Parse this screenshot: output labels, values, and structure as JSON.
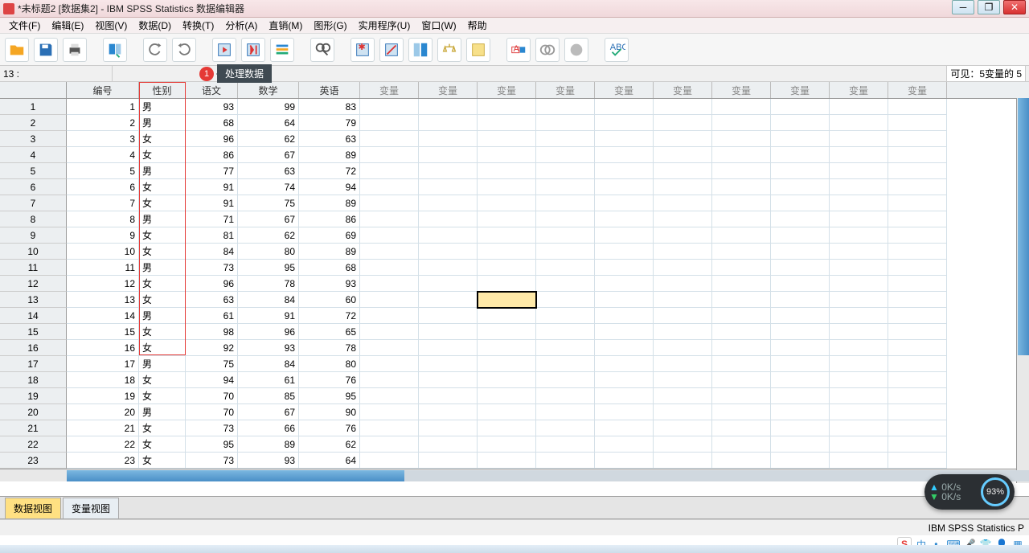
{
  "title": "*未标题2 [数据集2] - IBM SPSS Statistics 数据编辑器",
  "menu": [
    "文件(F)",
    "编辑(E)",
    "视图(V)",
    "数据(D)",
    "转换(T)",
    "分析(A)",
    "直销(M)",
    "图形(G)",
    "实用程序(U)",
    "窗口(W)",
    "帮助"
  ],
  "cellref": "13 :",
  "callout_num": "1",
  "callout_label": "处理数据",
  "visible_info": "可见：5变量的 5",
  "columns": [
    {
      "label": "编号",
      "w": 90,
      "align": "num"
    },
    {
      "label": "性别",
      "w": 58,
      "align": "txt"
    },
    {
      "label": "语文",
      "w": 65,
      "align": "num"
    },
    {
      "label": "数学",
      "w": 76,
      "align": "num"
    },
    {
      "label": "英语",
      "w": 76,
      "align": "num"
    }
  ],
  "empty_label": "变量",
  "empty_cols": 10,
  "empty_w": 73,
  "rows": [
    [
      1,
      "男",
      93,
      99,
      83
    ],
    [
      2,
      "男",
      68,
      64,
      79
    ],
    [
      3,
      "女",
      96,
      62,
      63
    ],
    [
      4,
      "女",
      86,
      67,
      89
    ],
    [
      5,
      "男",
      77,
      63,
      72
    ],
    [
      6,
      "女",
      91,
      74,
      94
    ],
    [
      7,
      "女",
      91,
      75,
      89
    ],
    [
      8,
      "男",
      71,
      67,
      86
    ],
    [
      9,
      "女",
      81,
      62,
      69
    ],
    [
      10,
      "女",
      84,
      80,
      89
    ],
    [
      11,
      "男",
      73,
      95,
      68
    ],
    [
      12,
      "女",
      96,
      78,
      93
    ],
    [
      13,
      "女",
      63,
      84,
      60
    ],
    [
      14,
      "男",
      61,
      91,
      72
    ],
    [
      15,
      "女",
      98,
      96,
      65
    ],
    [
      16,
      "女",
      92,
      93,
      78
    ],
    [
      17,
      "男",
      75,
      84,
      80
    ],
    [
      18,
      "女",
      94,
      61,
      76
    ],
    [
      19,
      "女",
      70,
      85,
      95
    ],
    [
      20,
      "男",
      70,
      67,
      90
    ],
    [
      21,
      "女",
      73,
      66,
      76
    ],
    [
      22,
      "女",
      95,
      89,
      62
    ],
    [
      23,
      "女",
      73,
      93,
      64
    ]
  ],
  "selected_cell": {
    "row": 13,
    "empty_col": 3
  },
  "redbox_col": 1,
  "tabs": {
    "active": "数据视图",
    "other": "变量视图"
  },
  "status": "IBM SPSS Statistics P",
  "perf": {
    "up": "0K/s",
    "down": "0K/s",
    "ring": "93%"
  },
  "tray_text": "中"
}
